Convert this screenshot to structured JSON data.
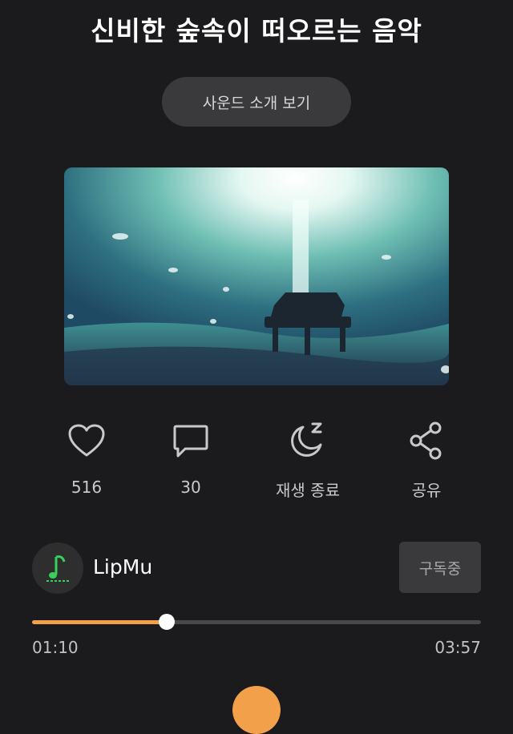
{
  "title": "신비한 숲속이 떠오르는 음악",
  "intro_button": "사운드 소개 보기",
  "artwork": {
    "icon": "piano-forest-artwork"
  },
  "actions": {
    "like": {
      "icon": "heart-icon",
      "label": "516"
    },
    "comment": {
      "icon": "comment-icon",
      "label": "30"
    },
    "sleep_timer": {
      "icon": "moon-sleep-icon",
      "label": "재생 종료"
    },
    "share": {
      "icon": "share-icon",
      "label": "공유"
    }
  },
  "channel": {
    "name": "LipMu",
    "subscribe_label": "구독중"
  },
  "player": {
    "current_time": "01:10",
    "total_time": "03:57",
    "progress": 0.3
  },
  "colors": {
    "accent": "#f2a14a",
    "background": "#1b1a1c"
  }
}
